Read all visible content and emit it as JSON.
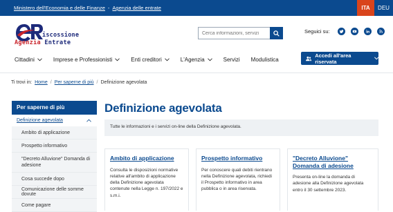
{
  "topbar": {
    "ministry": "Ministero dell'Economia e delle Finanze",
    "separator": "-",
    "agency": "Agenzia delle entrate",
    "langs": [
      "ITA",
      "DEU"
    ]
  },
  "logo": {
    "line1": "iscossione",
    "line2_a": "Agenzia",
    "line2_b": "Entrate"
  },
  "search": {
    "placeholder": "Cerca informazioni, servizi"
  },
  "social": {
    "label": "Seguici su:",
    "icons": [
      "twitter-icon",
      "youtube-icon",
      "linkedin-icon",
      "rss-icon"
    ]
  },
  "nav": {
    "items": [
      "Cittadini",
      "Imprese e Professionisti",
      "Enti creditori",
      "L'Agenzia",
      "Servizi",
      "Modulistica"
    ],
    "cta": "Accedi all'area riservata"
  },
  "breadcrumb": {
    "prefix": "Ti trovi in:",
    "home": "Home",
    "sep": "/",
    "parent": "Per saperne di più",
    "current": "Definizione agevolata"
  },
  "sidebar": {
    "heading": "Per saperne di più",
    "active": "Definizione agevolata",
    "items": [
      "Ambito di applicazione",
      "Prospetto informativo",
      "\"Decreto Alluvione\" Domanda di adesione",
      "Cosa succede dopo",
      "Comunicazione delle somme dovute",
      "Come pagare"
    ]
  },
  "main": {
    "title": "Definizione agevolata",
    "intro": "Tutte le informazioni e i servizi on-line della Definizione agevolata.",
    "cards": [
      {
        "title": "Ambito di applicazione",
        "body": "Consulta le disposizioni normative relative all'ambito di applicazione della Definizione agevolata contenute nella Legge n. 197/2022 e s.m.i."
      },
      {
        "title": "Prospetto informativo",
        "body": "Per conoscere quali debiti rientrano nella Definizione agevolata, richiedi il Prospetto informativo in area pubblica o in area riservata."
      },
      {
        "title": "\"Decreto Alluvione\" Domanda di adesione",
        "body": "Presenta on-line la domanda di adesione alla Definizione agevolata entro il 30 settembre 2023."
      }
    ]
  },
  "colors": {
    "brand": "#0b4a8f",
    "accent": "#d9441c",
    "logo_red": "#c9242b"
  }
}
